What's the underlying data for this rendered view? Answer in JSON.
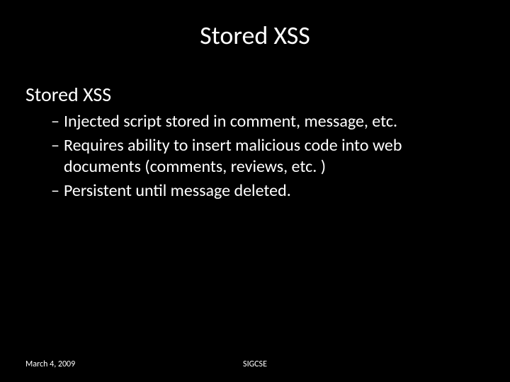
{
  "slide": {
    "title": "Stored XSS",
    "subtitle": "Stored XSS",
    "bullets": [
      "Injected script stored in comment, message, etc.",
      "Requires ability to insert malicious code into web documents (comments, reviews, etc. )",
      "Persistent until message deleted."
    ],
    "footer": {
      "date": "March 4, 2009",
      "venue": "SIGCSE"
    }
  }
}
